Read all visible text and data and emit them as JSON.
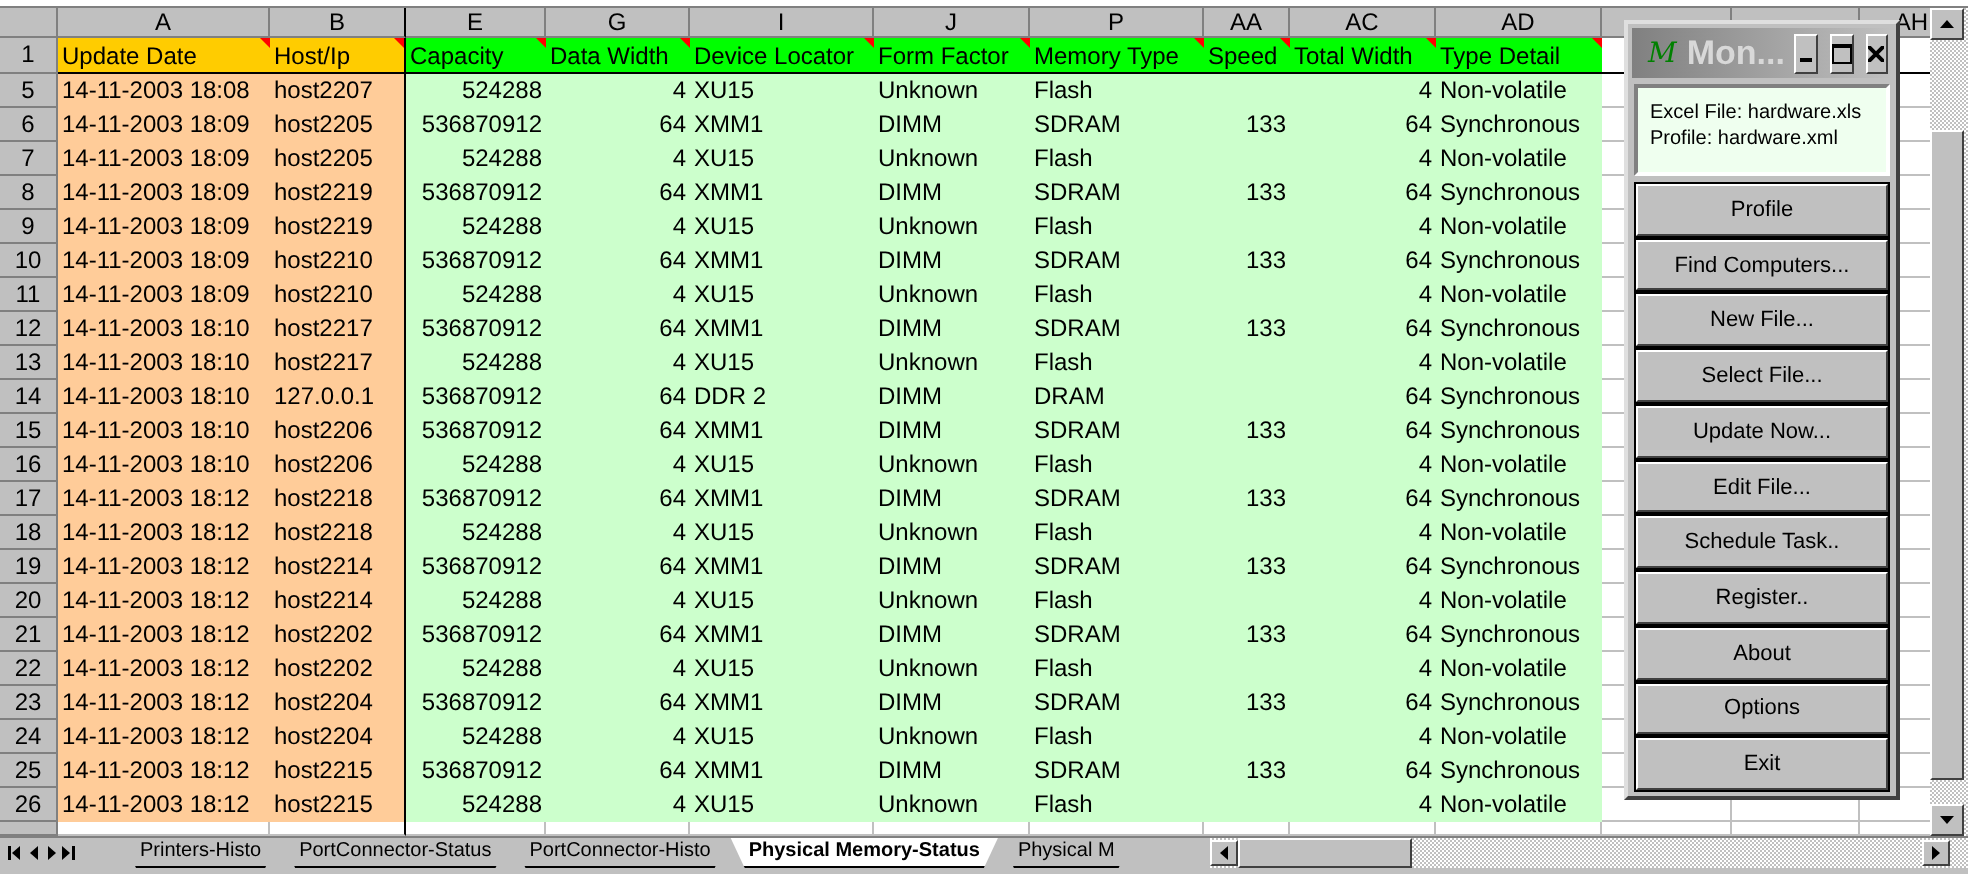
{
  "columns": [
    {
      "letter": "A",
      "header": "Update Date",
      "kind": "key",
      "has_comment": true
    },
    {
      "letter": "B",
      "header": "Host/Ip",
      "kind": "key",
      "has_comment": true
    },
    {
      "letter": "E",
      "header": "Capacity",
      "kind": "value",
      "has_comment": true
    },
    {
      "letter": "G",
      "header": "Data Width",
      "kind": "value",
      "has_comment": true
    },
    {
      "letter": "I",
      "header": "Device Locator",
      "kind": "value",
      "has_comment": true
    },
    {
      "letter": "J",
      "header": "Form Factor",
      "kind": "value",
      "has_comment": true
    },
    {
      "letter": "P",
      "header": "Memory Type",
      "kind": "value",
      "has_comment": true
    },
    {
      "letter": "AA",
      "header": "Speed",
      "kind": "value",
      "has_comment": true
    },
    {
      "letter": "AC",
      "header": "Total Width",
      "kind": "value",
      "has_comment": true
    },
    {
      "letter": "AD",
      "header": "Type Detail",
      "kind": "value",
      "has_comment": true
    }
  ],
  "extra_columns": [
    {
      "letter": "AH"
    }
  ],
  "header_row_number": "1",
  "rows": [
    {
      "number": "5",
      "cells": [
        "14-11-2003 18:08",
        "host2207",
        "524288",
        "4",
        "XU15",
        "Unknown",
        "Flash",
        null,
        "4",
        "Non-volatile"
      ]
    },
    {
      "number": "6",
      "cells": [
        "14-11-2003 18:09",
        "host2205",
        "536870912",
        "64",
        "XMM1",
        "DIMM",
        "SDRAM",
        "133",
        "64",
        "Synchronous"
      ]
    },
    {
      "number": "7",
      "cells": [
        "14-11-2003 18:09",
        "host2205",
        "524288",
        "4",
        "XU15",
        "Unknown",
        "Flash",
        null,
        "4",
        "Non-volatile"
      ]
    },
    {
      "number": "8",
      "cells": [
        "14-11-2003 18:09",
        "host2219",
        "536870912",
        "64",
        "XMM1",
        "DIMM",
        "SDRAM",
        "133",
        "64",
        "Synchronous"
      ]
    },
    {
      "number": "9",
      "cells": [
        "14-11-2003 18:09",
        "host2219",
        "524288",
        "4",
        "XU15",
        "Unknown",
        "Flash",
        null,
        "4",
        "Non-volatile"
      ]
    },
    {
      "number": "10",
      "cells": [
        "14-11-2003 18:09",
        "host2210",
        "536870912",
        "64",
        "XMM1",
        "DIMM",
        "SDRAM",
        "133",
        "64",
        "Synchronous"
      ]
    },
    {
      "number": "11",
      "cells": [
        "14-11-2003 18:09",
        "host2210",
        "524288",
        "4",
        "XU15",
        "Unknown",
        "Flash",
        null,
        "4",
        "Non-volatile"
      ]
    },
    {
      "number": "12",
      "cells": [
        "14-11-2003 18:10",
        "host2217",
        "536870912",
        "64",
        "XMM1",
        "DIMM",
        "SDRAM",
        "133",
        "64",
        "Synchronous"
      ]
    },
    {
      "number": "13",
      "cells": [
        "14-11-2003 18:10",
        "host2217",
        "524288",
        "4",
        "XU15",
        "Unknown",
        "Flash",
        null,
        "4",
        "Non-volatile"
      ]
    },
    {
      "number": "14",
      "cells": [
        "14-11-2003 18:10",
        "127.0.0.1",
        "536870912",
        "64",
        "DDR 2",
        "DIMM",
        "DRAM",
        null,
        "64",
        "Synchronous"
      ]
    },
    {
      "number": "15",
      "cells": [
        "14-11-2003 18:10",
        "host2206",
        "536870912",
        "64",
        "XMM1",
        "DIMM",
        "SDRAM",
        "133",
        "64",
        "Synchronous"
      ]
    },
    {
      "number": "16",
      "cells": [
        "14-11-2003 18:10",
        "host2206",
        "524288",
        "4",
        "XU15",
        "Unknown",
        "Flash",
        null,
        "4",
        "Non-volatile"
      ]
    },
    {
      "number": "17",
      "cells": [
        "14-11-2003 18:12",
        "host2218",
        "536870912",
        "64",
        "XMM1",
        "DIMM",
        "SDRAM",
        "133",
        "64",
        "Synchronous"
      ]
    },
    {
      "number": "18",
      "cells": [
        "14-11-2003 18:12",
        "host2218",
        "524288",
        "4",
        "XU15",
        "Unknown",
        "Flash",
        null,
        "4",
        "Non-volatile"
      ]
    },
    {
      "number": "19",
      "cells": [
        "14-11-2003 18:12",
        "host2214",
        "536870912",
        "64",
        "XMM1",
        "DIMM",
        "SDRAM",
        "133",
        "64",
        "Synchronous"
      ]
    },
    {
      "number": "20",
      "cells": [
        "14-11-2003 18:12",
        "host2214",
        "524288",
        "4",
        "XU15",
        "Unknown",
        "Flash",
        null,
        "4",
        "Non-volatile"
      ]
    },
    {
      "number": "21",
      "cells": [
        "14-11-2003 18:12",
        "host2202",
        "536870912",
        "64",
        "XMM1",
        "DIMM",
        "SDRAM",
        "133",
        "64",
        "Synchronous"
      ]
    },
    {
      "number": "22",
      "cells": [
        "14-11-2003 18:12",
        "host2202",
        "524288",
        "4",
        "XU15",
        "Unknown",
        "Flash",
        null,
        "4",
        "Non-volatile"
      ]
    },
    {
      "number": "23",
      "cells": [
        "14-11-2003 18:12",
        "host2204",
        "536870912",
        "64",
        "XMM1",
        "DIMM",
        "SDRAM",
        "133",
        "64",
        "Synchronous"
      ]
    },
    {
      "number": "24",
      "cells": [
        "14-11-2003 18:12",
        "host2204",
        "524288",
        "4",
        "XU15",
        "Unknown",
        "Flash",
        null,
        "4",
        "Non-volatile"
      ]
    },
    {
      "number": "25",
      "cells": [
        "14-11-2003 18:12",
        "host2215",
        "536870912",
        "64",
        "XMM1",
        "DIMM",
        "SDRAM",
        "133",
        "64",
        "Synchronous"
      ]
    },
    {
      "number": "26",
      "cells": [
        "14-11-2003 18:12",
        "host2215",
        "524288",
        "4",
        "XU15",
        "Unknown",
        "Flash",
        null,
        "4",
        "Non-volatile"
      ]
    }
  ],
  "sheet_tabs": [
    {
      "label": "Printers-Histo",
      "selected": false
    },
    {
      "label": "PortConnector-Status",
      "selected": false
    },
    {
      "label": "PortConnector-Histo",
      "selected": false
    },
    {
      "label": "Physical Memory-Status",
      "selected": true
    },
    {
      "label": "Physical M",
      "selected": false
    }
  ],
  "panel": {
    "logo": "M",
    "title": "Mon...",
    "info": [
      "Excel File: hardware.xls",
      "Profile: hardware.xml"
    ],
    "buttons": [
      "Profile",
      "Find Computers...",
      "New File...",
      "Select File...",
      "Update Now...",
      "Edit File...",
      "Schedule Task..",
      "Register..",
      "About",
      "Options",
      "Exit"
    ]
  }
}
